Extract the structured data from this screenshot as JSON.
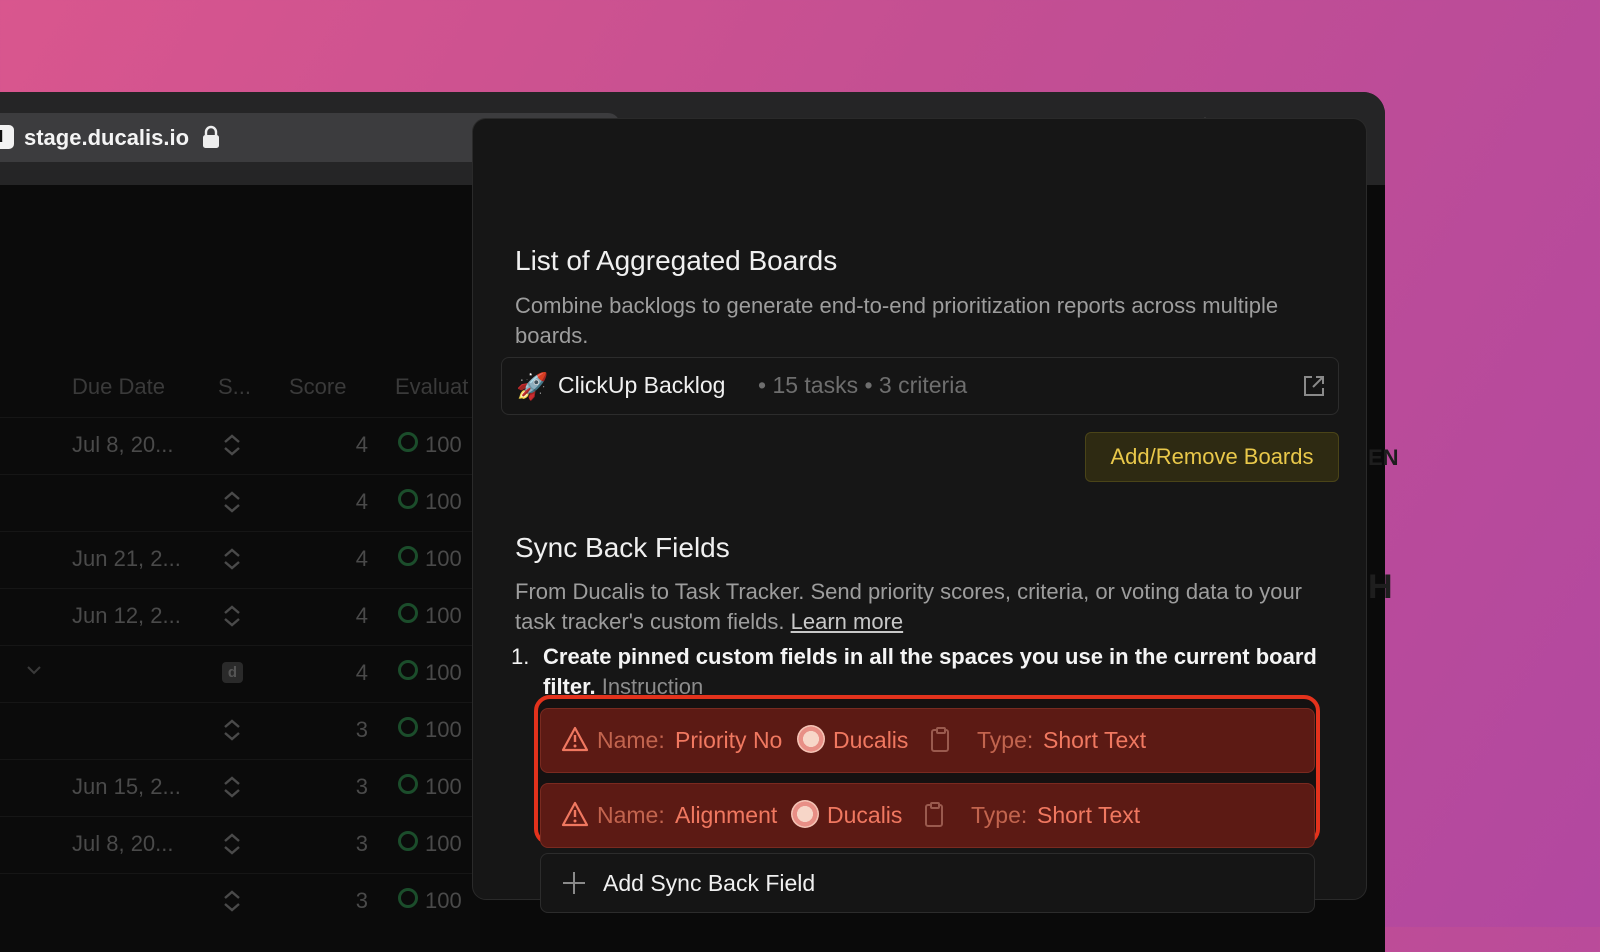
{
  "browser": {
    "url": "stage.ducalis.io",
    "favicon_letter": "d"
  },
  "table": {
    "headers": [
      "Due Date",
      "S...",
      "Score",
      "Evaluat"
    ],
    "rows": [
      {
        "date": "Jul 8, 20...",
        "score": "4",
        "eval": "100"
      },
      {
        "date": "",
        "score": "4",
        "eval": "100"
      },
      {
        "date": "Jun 21, 2...",
        "score": "4",
        "eval": "100"
      },
      {
        "date": "Jun 12, 2...",
        "score": "4",
        "eval": "100"
      },
      {
        "date": "",
        "score": "4",
        "eval": "100"
      },
      {
        "date": "",
        "score": "3",
        "eval": "100"
      },
      {
        "date": "Jun 15, 2...",
        "score": "3",
        "eval": "100"
      },
      {
        "date": "Jul 8, 20...",
        "score": "3",
        "eval": "100"
      },
      {
        "date": "",
        "score": "3",
        "eval": "100"
      }
    ]
  },
  "panel": {
    "aggregated": {
      "title": "List of Aggregated Boards",
      "description": "Combine backlogs to generate end-to-end prioritization reports across multiple boards.",
      "board": {
        "emoji": "🚀",
        "name": "ClickUp Backlog",
        "meta": "• 15 tasks • 3 criteria"
      },
      "add_remove_label": "Add/Remove Boards"
    },
    "sync": {
      "title": "Sync Back Fields",
      "description": "From Ducalis to Task Tracker. Send priority scores, criteria, or voting data to your task tracker's custom fields.",
      "learn_more": "Learn more",
      "step_number": "1.",
      "step_text": "Create pinned custom fields in all the spaces you use in the current board filter.",
      "step_link": "Instruction",
      "fields": [
        {
          "name_label": "Name:",
          "name": "Priority No",
          "source": "Ducalis",
          "type_label": "Type:",
          "type": "Short Text"
        },
        {
          "name_label": "Name:",
          "name": "Alignment",
          "source": "Ducalis",
          "type_label": "Type:",
          "type": "Short Text"
        }
      ],
      "add_field_label": "Add Sync Back Field"
    }
  },
  "colors": {
    "accent_yellow": "#e9c84a",
    "error_red": "#e3321c",
    "success_green": "#1b4d2b"
  }
}
